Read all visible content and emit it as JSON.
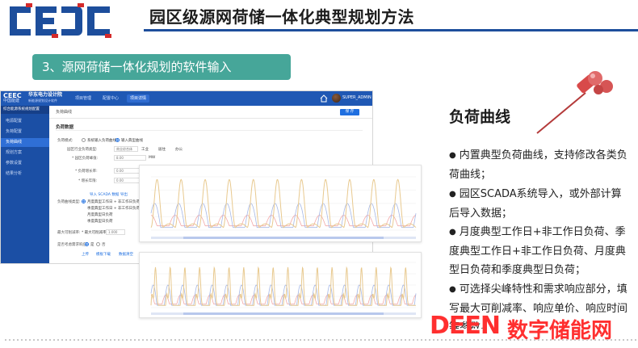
{
  "slide": {
    "logo_text": "CEEC",
    "title": "园区级源网荷储一体化典型规划方法",
    "section_label": "3、源网荷储一体化规划的软件输入",
    "colors": {
      "brand_blue": "#1d4e9c",
      "section_green": "#46a699",
      "watermark_red": "#ff2f2f"
    }
  },
  "app": {
    "logo": "CEEC",
    "org": "中国能建",
    "company": "华东电力设计院",
    "product": "新能源规划设计软件",
    "tabs": [
      {
        "label": "项目管理",
        "active": false
      },
      {
        "label": "配置中心",
        "active": false
      },
      {
        "label": "项目详情",
        "active": true
      }
    ],
    "user": "SUPER_ADMIN",
    "sidebar": {
      "header": "综合能源系统规划配置",
      "items": [
        {
          "label": "电源配置",
          "active": false
        },
        {
          "label": "负荷配置",
          "active": false
        },
        {
          "label": "负荷曲线",
          "active": true
        },
        {
          "label": "规划方案",
          "active": false
        },
        {
          "label": "参数设置",
          "active": false
        },
        {
          "label": "结果分析",
          "active": false
        }
      ]
    },
    "panel_tab": "负荷曲线",
    "save_label": "保 存",
    "form_title": "负荷数据",
    "form": {
      "input_mode_label": "负荷模式:",
      "input_mode_options": [
        "系统输入负荷曲线",
        "输入典型曲线"
      ],
      "industry_label": "园区行业负荷类型:",
      "industry_value": "商业综合体",
      "industry_opts": [
        "工业",
        "居住",
        "办公"
      ],
      "peak_label": "* 园区负荷峰值:",
      "peak_value": "8.00",
      "peak_unit": "MW",
      "growth_label": "* 负荷增长率:",
      "growth_value": "0.00",
      "rate_label": "* 增长年限:",
      "rate_value": "0.00",
      "import_link": "导入 SCADA 数据",
      "export_link": "导出",
      "curve_label": "负荷曲线类型:",
      "curve_options": [
        "月度典型工作日 + 非工作日负荷",
        "季度典型工作日 + 非工作日负荷",
        "月度典型日负荷",
        "季度典型日负荷"
      ],
      "max_label": "最大可削减率:",
      "max_value": "1.000",
      "demand_label": "是否考虑需求响应:",
      "demand_yes": "是",
      "demand_no": "否",
      "actions": [
        "上传",
        "模板下载",
        "数据清空"
      ]
    },
    "charts": {
      "legend": [
        "负荷数据",
        "峰谷负荷",
        "需求响应负荷"
      ],
      "series_colors": [
        "#e8c98f",
        "#a6b8e6",
        "#f2a8a8"
      ],
      "unit": "万kW"
    }
  },
  "right_panel": {
    "heading": "负荷曲线",
    "bullets": [
      "内置典型负荷曲线，支持修改各类负荷曲线；",
      "园区SCADA系统导入，或外部计算后导入数据；",
      "月度典型工作日+非工作日负荷、季度典型工作日+非工作日负荷、月度典型日负荷和季度典型日负荷；",
      "可选择尖峰特性和需求响应部分，填写最大可削减率、响应单价、响应时间等参数。"
    ]
  },
  "watermark": {
    "latin": "DEEN",
    "cn": "数字储能网"
  }
}
